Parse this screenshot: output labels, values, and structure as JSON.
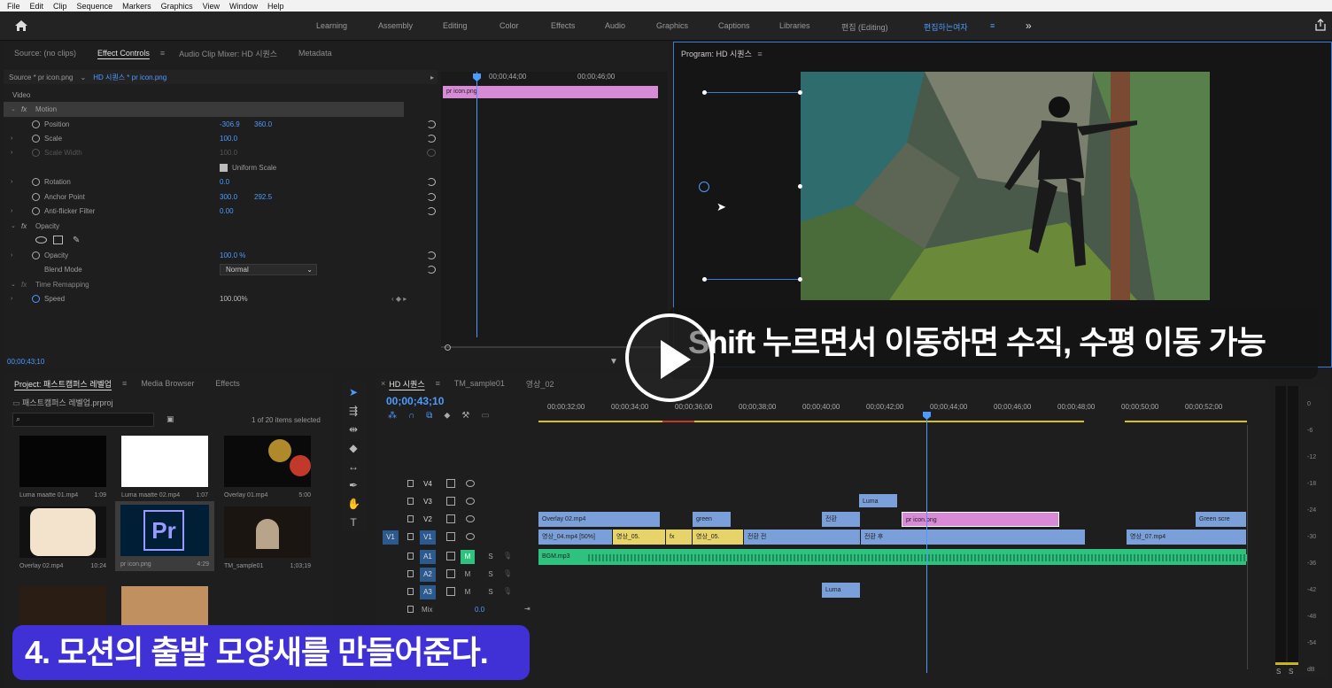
{
  "menu": [
    "File",
    "Edit",
    "Clip",
    "Sequence",
    "Markers",
    "Graphics",
    "View",
    "Window",
    "Help"
  ],
  "workspaces": [
    "Learning",
    "Assembly",
    "Editing",
    "Color",
    "Effects",
    "Audio",
    "Graphics",
    "Captions",
    "Libraries",
    "편집 (Editing)",
    "편집하는여자"
  ],
  "source_tabs": {
    "source": "Source: (no clips)",
    "effect_controls": "Effect Controls",
    "audio_mixer": "Audio Clip Mixer: HD 시퀀스",
    "metadata": "Metadata"
  },
  "ec": {
    "master": "Source * pr icon.png",
    "sequence": "HD 시퀀스 * pr icon.png",
    "section_video": "Video",
    "rows": [
      {
        "name": "Motion",
        "fx": true,
        "header": true
      },
      {
        "name": "Position",
        "v1": "-306.9",
        "v2": "360.0"
      },
      {
        "name": "Scale",
        "v1": "100.0"
      },
      {
        "name": "Scale Width",
        "v1": "100.0",
        "dim": true
      },
      {
        "name": "Uniform Scale",
        "check": true
      },
      {
        "name": "Rotation",
        "v1": "0.0"
      },
      {
        "name": "Anchor Point",
        "v1": "300.0",
        "v2": "292.5"
      },
      {
        "name": "Anti-flicker Filter",
        "v1": "0.00"
      },
      {
        "name": "Opacity",
        "fx": true
      },
      {
        "name": "",
        "masks": true
      },
      {
        "name": "Opacity",
        "v1": "100.0 %"
      },
      {
        "name": "Blend Mode",
        "select": "Normal"
      },
      {
        "name": "Time Remapping",
        "fx": true,
        "dim": true
      },
      {
        "name": "Speed",
        "v1": "100.00%",
        "white": true
      }
    ],
    "ruler": [
      "00;00;44;00",
      "00;00;46;00"
    ],
    "clip": "pr icon.png",
    "timecode": "00;00;43;10"
  },
  "program": {
    "title": "Program: HD 시퀀스"
  },
  "project": {
    "tabs": [
      "Project: 패스트캠퍼스 레벨업",
      "Media Browser",
      "Effects"
    ],
    "path": "패스트캠퍼스 레벨업.prproj",
    "count": "1 of 20 items selected",
    "items": [
      {
        "name": "Luma maatte 01.mp4",
        "dur": "1:09"
      },
      {
        "name": "Luma maatte 02.mp4",
        "dur": "1:07"
      },
      {
        "name": "Overlay 01.mp4",
        "dur": "5:00"
      },
      {
        "name": "Overlay 02.mp4",
        "dur": "10:24"
      },
      {
        "name": "pr icon.png",
        "dur": "4:29"
      },
      {
        "name": "TM_sample01",
        "dur": "1;03;19"
      }
    ]
  },
  "timeline": {
    "tabs": [
      "HD 시퀀스",
      "TM_sample01",
      "영상_02"
    ],
    "timecode": "00;00;43;10",
    "ruler": [
      "00;00;32;00",
      "00;00;34;00",
      "00;00;36;00",
      "00;00;38;00",
      "00;00;40;00",
      "00;00;42;00",
      "00;00;44;00",
      "00;00;46;00",
      "00;00;48;00",
      "00;00;50;00",
      "00;00;52;00"
    ],
    "tracks": [
      "V4",
      "V3",
      "V2",
      "V1",
      "A1",
      "A2",
      "A3"
    ],
    "mix": "Mix",
    "mix_val": "0.0",
    "clips": {
      "overlay02": "Overlay 02.mp4",
      "green": "green",
      "luma": "Luma",
      "jh": "전환",
      "pricon": "pr icon.png",
      "greenscr": "Green scre",
      "v1a": "영상_04.mp4 [50%]",
      "v1b": "영상_05.",
      "v1c": "영상_05.",
      "v1d": "전환 전",
      "v1e": "전환 후",
      "v1f": "영상_07.mp4",
      "bgm": "BGM.mp3",
      "aluma": "Luma"
    }
  },
  "meter_labels": [
    "0",
    "-6",
    "-12",
    "-18",
    "-24",
    "-30",
    "-36",
    "-42",
    "-48",
    "-54",
    "dB"
  ],
  "caption_top": "Shift 누르면서 이동하면 수직, 수평 이동 가능",
  "caption_bottom": "4. 모션의 출발 모양새를 만들어준다."
}
